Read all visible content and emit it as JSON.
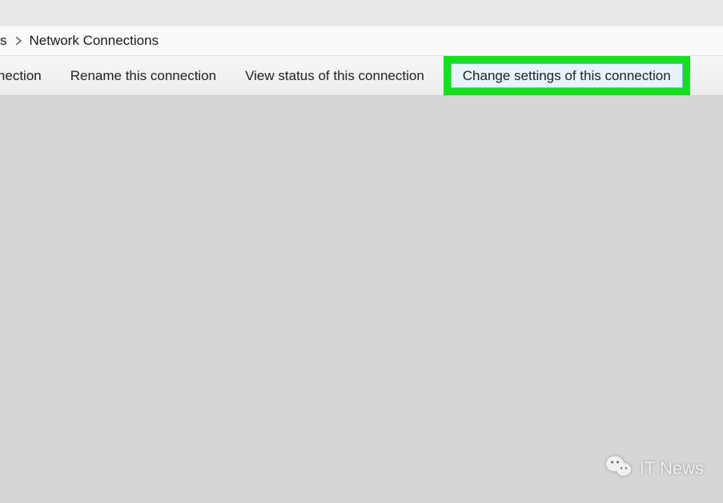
{
  "breadcrumb": {
    "partial_prev": "s",
    "current": "Network Connections"
  },
  "toolbar": {
    "item_partial": "onnection",
    "item_rename": "Rename this connection",
    "item_view_status": "View status of this connection",
    "item_change_settings": "Change settings of this connection"
  },
  "watermark": {
    "text": "IT News"
  },
  "highlight_color": "#13e21b"
}
